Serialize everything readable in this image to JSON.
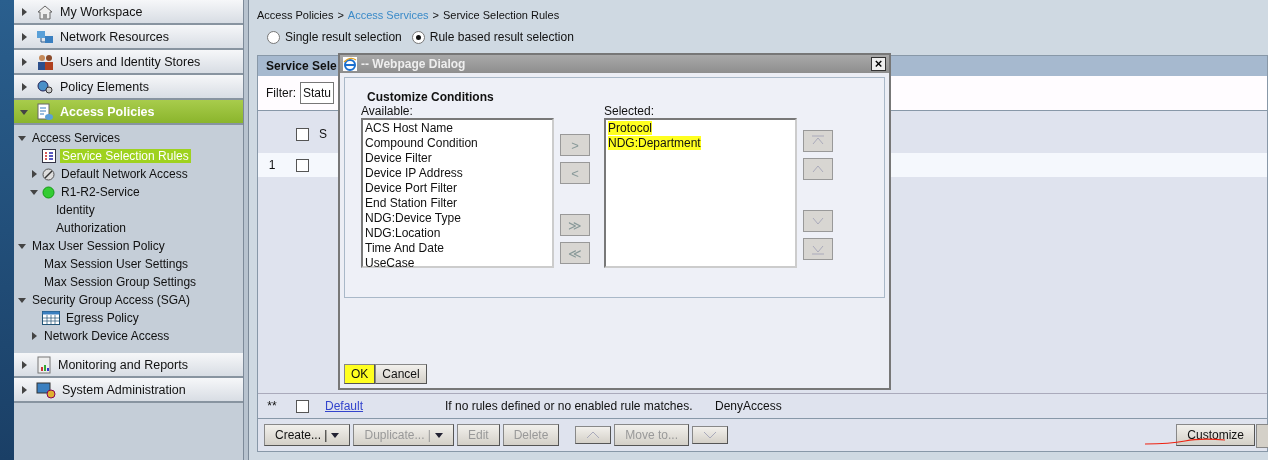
{
  "sidebar": {
    "drawers": [
      {
        "label": "My Workspace",
        "kind": "workspace",
        "expanded": false,
        "selected": false
      },
      {
        "label": "Network Resources",
        "kind": "network",
        "expanded": false,
        "selected": false
      },
      {
        "label": "Users and Identity Stores",
        "kind": "users",
        "expanded": false,
        "selected": false
      },
      {
        "label": "Policy Elements",
        "kind": "policy",
        "expanded": false,
        "selected": false
      },
      {
        "label": "Access Policies",
        "kind": "access",
        "expanded": true,
        "selected": true,
        "children": [
          {
            "label": "Access Services",
            "expanded": true,
            "selected": false,
            "children": [
              {
                "label": "Service Selection Rules",
                "kind": "rules",
                "selected": true
              },
              {
                "label": "Default Network Access",
                "kind": "disabled",
                "expanded": false,
                "selected": false
              },
              {
                "label": "R1-R2-Service",
                "kind": "status",
                "expanded": true,
                "selected": false,
                "children": [
                  {
                    "label": "Identity",
                    "selected": false
                  },
                  {
                    "label": "Authorization",
                    "selected": false
                  }
                ]
              }
            ]
          },
          {
            "label": "Max User Session Policy",
            "expanded": true,
            "selected": false,
            "children": [
              {
                "label": "Max Session User Settings",
                "selected": false
              },
              {
                "label": "Max Session Group Settings",
                "selected": false
              }
            ]
          },
          {
            "label": "Security Group Access (SGA)",
            "expanded": true,
            "selected": false,
            "children": [
              {
                "label": "Egress Policy",
                "kind": "table",
                "selected": false
              },
              {
                "label": "Network Device Access",
                "expanded": false,
                "selected": false
              }
            ]
          }
        ]
      },
      {
        "label": "Monitoring and Reports",
        "kind": "monitoring",
        "expanded": false,
        "selected": false
      },
      {
        "label": "System Administration",
        "kind": "admin",
        "expanded": false,
        "selected": false
      }
    ]
  },
  "breadcrumb": [
    {
      "label": "Access Policies",
      "link": false
    },
    {
      "label": "Access Services",
      "link": true
    },
    {
      "label": "Service Selection Rules",
      "link": false
    }
  ],
  "breadcrumb_separator": ">",
  "result_modes": [
    {
      "label": "Single result selection",
      "selected": false
    },
    {
      "label": "Rule based result selection",
      "selected": true
    }
  ],
  "panel": {
    "title": "Service Sele",
    "filter_label": "Filter:",
    "filter_value": "Statu",
    "header_checked": false,
    "header_col": "S",
    "rows": [
      {
        "number": "1",
        "checked": false
      }
    ],
    "default_row": {
      "number": "**",
      "checked": false,
      "name": "Default",
      "description": "If no rules defined or no enabled rule matches.",
      "result": "DenyAccess"
    }
  },
  "toolbar": [
    {
      "label": "Create... |",
      "dropdown": true,
      "disabled": false
    },
    {
      "label": "Duplicate... |",
      "dropdown": true,
      "disabled": true
    },
    {
      "label": "Edit",
      "dropdown": false,
      "disabled": true
    },
    {
      "label": "Delete",
      "dropdown": false,
      "disabled": true
    },
    {
      "kind": "up",
      "dropdown": false,
      "disabled": true
    },
    {
      "label": "Move to...",
      "dropdown": false,
      "disabled": true
    },
    {
      "kind": "down",
      "dropdown": false,
      "disabled": true
    }
  ],
  "customize_button": "Customize",
  "dialog": {
    "title": "-- Webpage Dialog",
    "close": "×",
    "heading": "Customize Conditions",
    "available_label": "Available:",
    "selected_label": "Selected:",
    "available": [
      "ACS Host Name",
      "Compound Condition",
      "Device Filter",
      "Device IP Address",
      "Device Port Filter",
      "End Station Filter",
      "NDG:Device Type",
      "NDG:Location",
      "Time And Date",
      "UseCase"
    ],
    "selected": [
      {
        "label": "Protocol",
        "highlighted": true
      },
      {
        "label": "NDG:Department",
        "highlighted": true
      }
    ],
    "transfer_buttons": [
      ">",
      "<",
      "≫",
      "≪"
    ],
    "order_buttons": [
      {
        "kind": "top"
      },
      {
        "kind": "up"
      },
      {
        "kind": "down"
      },
      {
        "kind": "bottom"
      }
    ],
    "buttons": [
      {
        "label": "OK",
        "highlighted": true
      },
      {
        "label": "Cancel",
        "highlighted": false
      }
    ]
  }
}
